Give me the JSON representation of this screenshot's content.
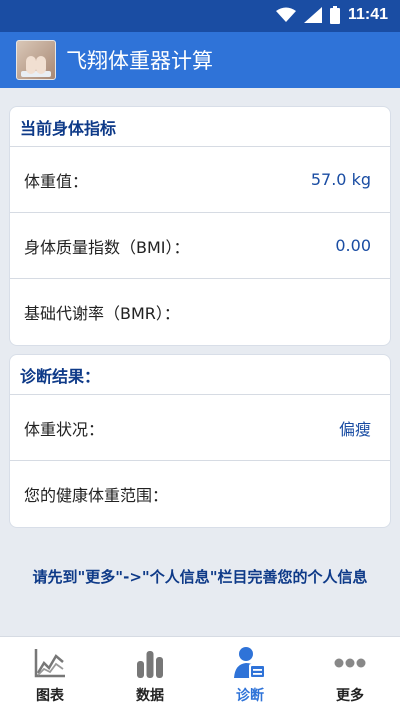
{
  "status_bar": {
    "time": "11:41",
    "wifi_icon": "wifi-icon",
    "signal_icon": "signal-icon",
    "battery_icon": "battery-icon"
  },
  "app_bar": {
    "title": "飞翔体重器计算",
    "logo_icon": "scale-logo-icon"
  },
  "body_metrics": {
    "header": "当前身体指标",
    "rows": [
      {
        "label": "体重值：",
        "value": "57.0 kg"
      },
      {
        "label": "身体质量指数（BMI）：",
        "value": "0.00"
      },
      {
        "label": "基础代谢率（BMR）：",
        "value": ""
      }
    ]
  },
  "diagnosis": {
    "header": "诊断结果：",
    "rows": [
      {
        "label": "体重状况：",
        "value": "偏瘦"
      },
      {
        "label": "您的健康体重范围：",
        "value": ""
      }
    ]
  },
  "notice": "请先到\"更多\"->\"个人信息\"栏目完善您的个人信息",
  "bottom_nav": {
    "items": [
      {
        "label": "图表",
        "icon": "line-chart-icon"
      },
      {
        "label": "数据",
        "icon": "bar-chart-icon"
      },
      {
        "label": "诊断",
        "icon": "user-report-icon"
      },
      {
        "label": "更多",
        "icon": "more-dots-icon"
      }
    ],
    "active_index": 2
  },
  "colors": {
    "status_bar": "#1a4da3",
    "app_bar": "#2f73d8",
    "header_text": "#0e3a88",
    "accent": "#2f73d8",
    "background": "#e7ebf1"
  }
}
